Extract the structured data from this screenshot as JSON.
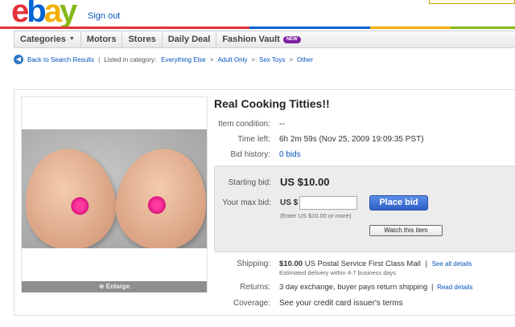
{
  "header": {
    "logo_letters": {
      "e": "e",
      "b": "b",
      "a": "a",
      "y": "y"
    },
    "sign_out": "Sign out"
  },
  "colors": {
    "bar": [
      "#e53238",
      "#e53238",
      "#0064d2",
      "#f5af02",
      "#86b817"
    ],
    "link": "#0654ba",
    "badge": "#7b1fa2"
  },
  "nav": {
    "categories": "Categories",
    "motors": "Motors",
    "stores": "Stores",
    "daily_deal": "Daily Deal",
    "fashion_vault": "Fashion Vault",
    "new_badge": "NEW"
  },
  "breadcrumb": {
    "back": "Back to Search Results",
    "separator": "|",
    "listed_in": "Listed in category:",
    "path": [
      "Everything Else",
      "Adult Only",
      "Sex Toys",
      "Other"
    ],
    "arrow": ">"
  },
  "item": {
    "title": "Real Cooking Titties!!",
    "enlarge": "Enlarge",
    "condition": {
      "label": "Item condition:",
      "value": "--"
    },
    "time_left": {
      "label": "Time left:",
      "value": "6h 2m 59s (Nov 25, 2009 19:09:35 PST)"
    },
    "bid_history": {
      "label": "Bid history:",
      "value": "0 bids"
    },
    "starting_bid": {
      "label": "Starting bid:",
      "value": "US $10.00"
    },
    "max_bid": {
      "label": "Your max bid:",
      "currency": "US $",
      "input_value": "",
      "hint": "(Enter US $10.00 or more)"
    },
    "place_bid": "Place bid",
    "watch": "Watch this item",
    "shipping": {
      "label": "Shipping:",
      "price": "$10.00",
      "service": "US Postal Service First Class Mail",
      "separator": "|",
      "see_all": "See all details",
      "delivery": "Estimated delivery within 4-7 business days"
    },
    "returns": {
      "label": "Returns:",
      "value": "3 day exchange, buyer pays return shipping",
      "separator": "|",
      "link": "Read details"
    },
    "coverage": {
      "label": "Coverage:",
      "value": "See your credit card issuer's terms"
    }
  }
}
